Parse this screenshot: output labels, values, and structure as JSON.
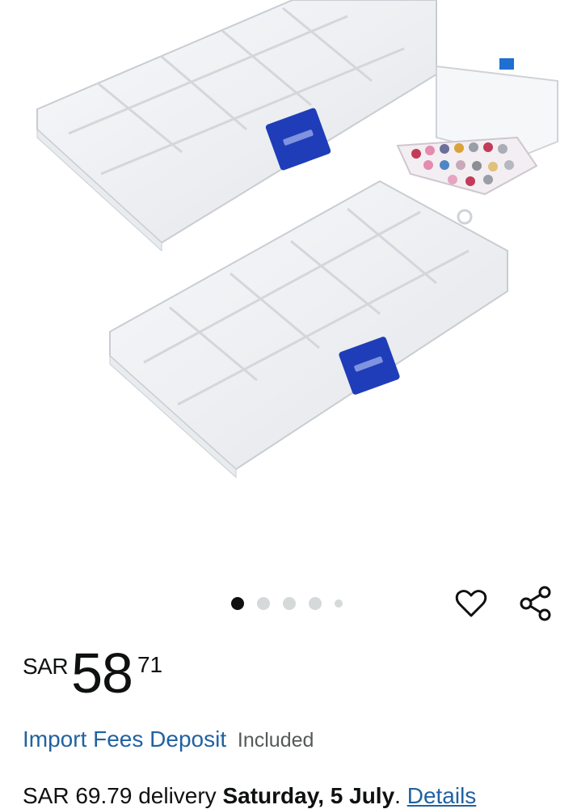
{
  "product": {
    "image_alt": "Clear plastic compartment storage boxes"
  },
  "carousel": {
    "count": 5,
    "active_index": 0
  },
  "actions": {
    "wishlist_icon": "heart-outline-icon",
    "share_icon": "share-icon"
  },
  "price": {
    "currency": "SAR",
    "whole": "58",
    "fraction": "71"
  },
  "import_fees": {
    "link_text": "Import Fees Deposit",
    "status": "Included"
  },
  "delivery": {
    "fee": "SAR 69.79 delivery",
    "date": "Saturday, 5 July",
    "separator": ".",
    "details_link": "Details"
  },
  "colors": {
    "link": "#2162a1",
    "latch": "#1f3db8",
    "text": "#0f1111"
  }
}
